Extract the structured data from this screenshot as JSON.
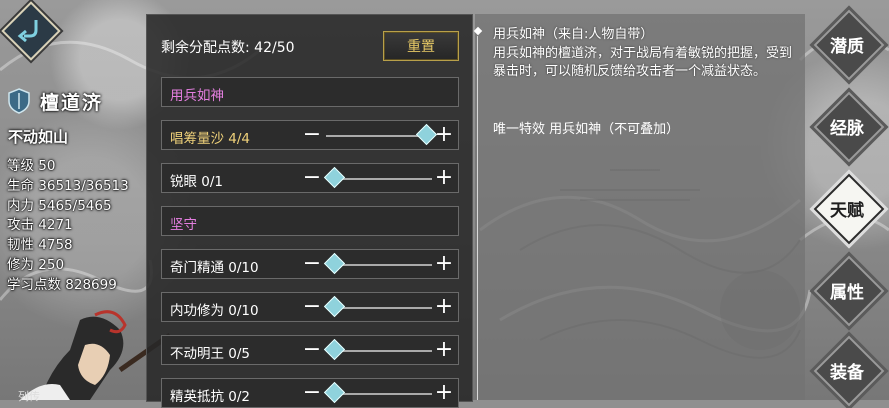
{
  "character": {
    "name": "檀道济",
    "title": "不动如山",
    "stats": [
      "等级 50",
      "生命 36513/36513",
      "内力 5465/5465",
      "攻击 4271",
      "韧性 4758",
      "修为 250",
      "学习点数 828699"
    ],
    "bottom_label": "列传"
  },
  "panel": {
    "points_label": "剩余分配点数: 42/50",
    "reset_label": "重置",
    "rows": [
      {
        "type": "header",
        "label": "用兵如神"
      },
      {
        "type": "skill",
        "label": "唱筹量沙 4/4",
        "highlight": true,
        "level": 4,
        "max": 4
      },
      {
        "type": "skill",
        "label": "锐眼 0/1",
        "level": 0,
        "max": 1
      },
      {
        "type": "header",
        "label": "坚守"
      },
      {
        "type": "skill",
        "label": "奇门精通 0/10",
        "level": 0,
        "max": 10
      },
      {
        "type": "skill",
        "label": "内功修为 0/10",
        "level": 0,
        "max": 10
      },
      {
        "type": "skill",
        "label": "不动明王 0/5",
        "level": 0,
        "max": 5
      },
      {
        "type": "skill",
        "label": "精英抵抗 0/2",
        "level": 0,
        "max": 2
      }
    ]
  },
  "description": {
    "lines": [
      "用兵如神（来自:人物自带）",
      "用兵如神的檀道济，对于战局有着敏锐的把握，受到暴击时，可以随机反馈给攻击者一个减益状态。"
    ],
    "effect": "唯一特效 用兵如神（不可叠加）"
  },
  "tabs": [
    {
      "label": "潜质",
      "active": false
    },
    {
      "label": "经脉",
      "active": false
    },
    {
      "label": "天赋",
      "active": true
    },
    {
      "label": "属性",
      "active": false
    },
    {
      "label": "装备",
      "active": false
    }
  ],
  "colors": {
    "header_text": "#e47fe0",
    "highlight_text": "#f0d27a",
    "knob": "#8fd2dc",
    "reset_border": "#b8a04a"
  }
}
